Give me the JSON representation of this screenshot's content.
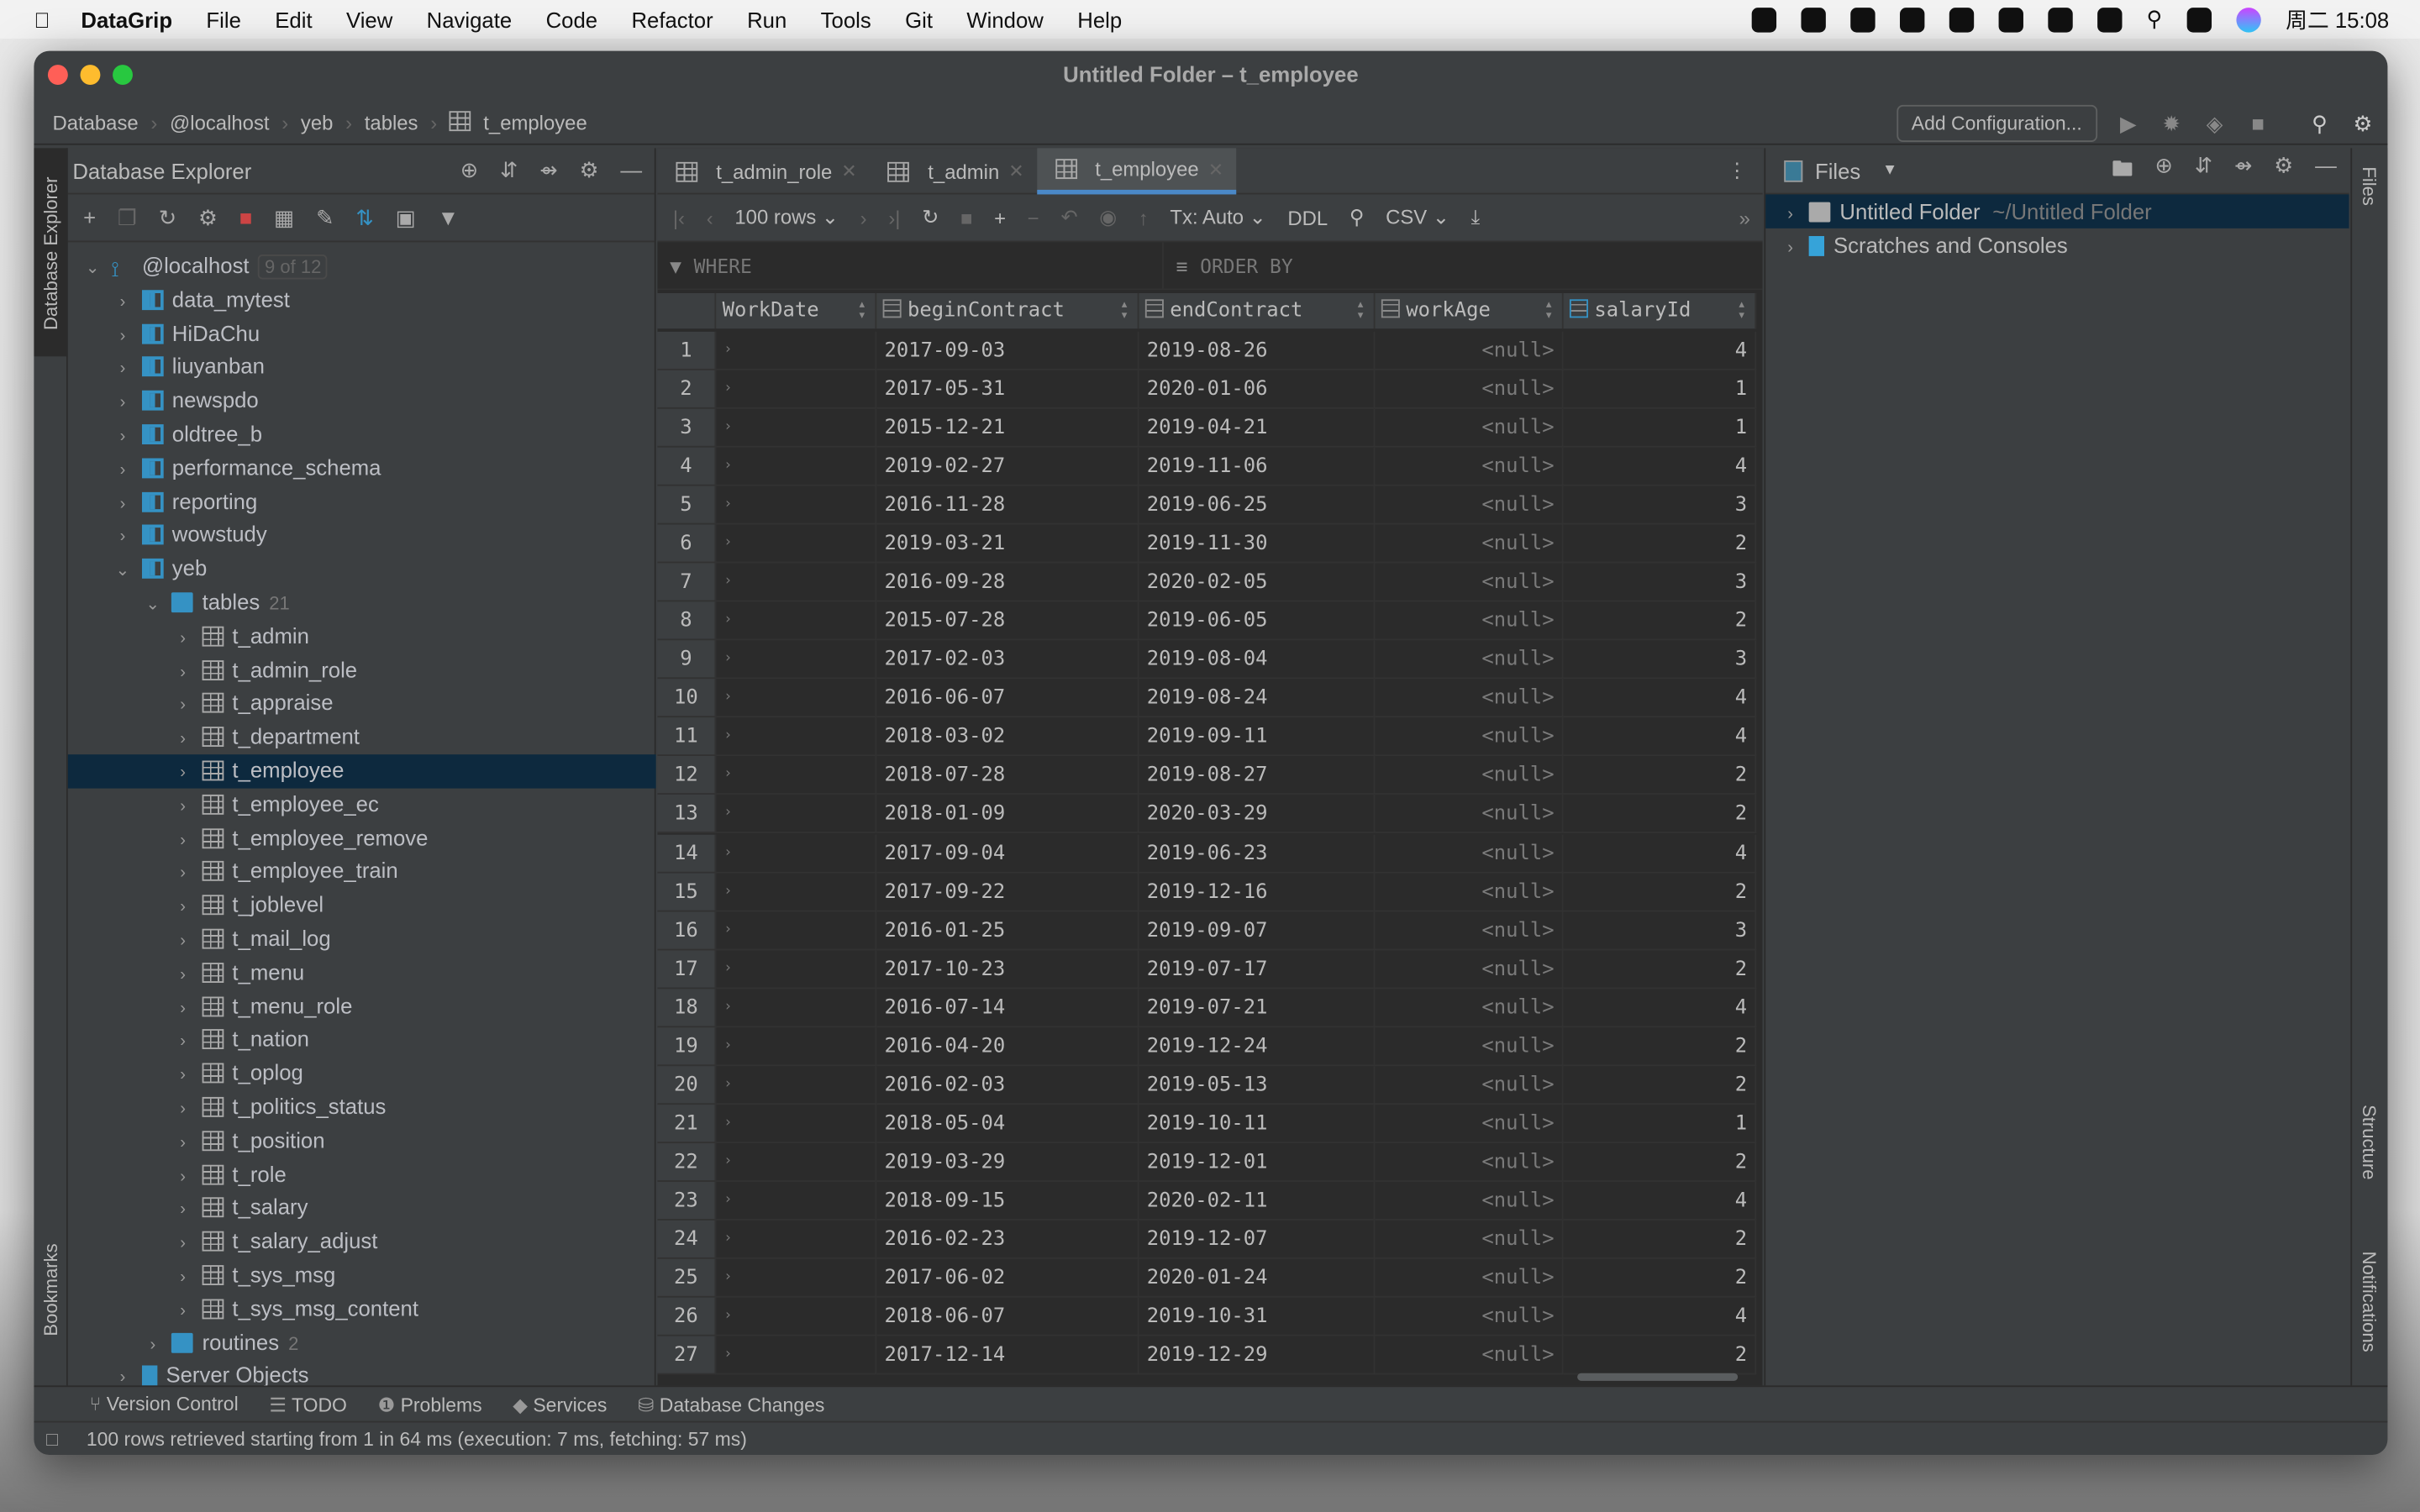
{
  "menubar": {
    "app": "DataGrip",
    "items": [
      "File",
      "Edit",
      "View",
      "Navigate",
      "Code",
      "Refactor",
      "Run",
      "Tools",
      "Git",
      "Window",
      "Help"
    ],
    "clock": "周二 15:08"
  },
  "window": {
    "title": "Untitled Folder – t_employee"
  },
  "breadcrumb": [
    "Database",
    "@localhost",
    "yeb",
    "tables",
    "t_employee"
  ],
  "toolbar": {
    "add_configuration": "Add Configuration..."
  },
  "left_stripe": {
    "database_explorer": "Database Explorer",
    "bookmarks": "Bookmarks"
  },
  "db_explorer": {
    "title": "Database Explorer",
    "tree": [
      {
        "label": "@localhost",
        "level": 0,
        "icon": "mysql-connection-icon",
        "expanded": true,
        "badge": "9 of 12"
      },
      {
        "label": "data_mytest",
        "level": 1,
        "icon": "schema-icon"
      },
      {
        "label": "HiDaChu",
        "level": 1,
        "icon": "schema-icon"
      },
      {
        "label": "liuyanban",
        "level": 1,
        "icon": "schema-icon"
      },
      {
        "label": "newspdo",
        "level": 1,
        "icon": "schema-icon"
      },
      {
        "label": "oldtree_b",
        "level": 1,
        "icon": "schema-icon"
      },
      {
        "label": "performance_schema",
        "level": 1,
        "icon": "schema-icon"
      },
      {
        "label": "reporting",
        "level": 1,
        "icon": "schema-icon"
      },
      {
        "label": "wowstudy",
        "level": 1,
        "icon": "schema-icon"
      },
      {
        "label": "yeb",
        "level": 1,
        "icon": "schema-icon",
        "expanded": true
      },
      {
        "label": "tables",
        "level": 2,
        "icon": "folder-icon",
        "expanded": true,
        "count": "21"
      },
      {
        "label": "t_admin",
        "level": 3,
        "icon": "table-icon"
      },
      {
        "label": "t_admin_role",
        "level": 3,
        "icon": "table-icon"
      },
      {
        "label": "t_appraise",
        "level": 3,
        "icon": "table-icon"
      },
      {
        "label": "t_department",
        "level": 3,
        "icon": "table-icon"
      },
      {
        "label": "t_employee",
        "level": 3,
        "icon": "table-icon",
        "selected": true
      },
      {
        "label": "t_employee_ec",
        "level": 3,
        "icon": "table-icon"
      },
      {
        "label": "t_employee_remove",
        "level": 3,
        "icon": "table-icon"
      },
      {
        "label": "t_employee_train",
        "level": 3,
        "icon": "table-icon"
      },
      {
        "label": "t_joblevel",
        "level": 3,
        "icon": "table-icon"
      },
      {
        "label": "t_mail_log",
        "level": 3,
        "icon": "table-icon"
      },
      {
        "label": "t_menu",
        "level": 3,
        "icon": "table-icon"
      },
      {
        "label": "t_menu_role",
        "level": 3,
        "icon": "table-icon"
      },
      {
        "label": "t_nation",
        "level": 3,
        "icon": "table-icon"
      },
      {
        "label": "t_oplog",
        "level": 3,
        "icon": "table-icon"
      },
      {
        "label": "t_politics_status",
        "level": 3,
        "icon": "table-icon"
      },
      {
        "label": "t_position",
        "level": 3,
        "icon": "table-icon"
      },
      {
        "label": "t_role",
        "level": 3,
        "icon": "table-icon"
      },
      {
        "label": "t_salary",
        "level": 3,
        "icon": "table-icon"
      },
      {
        "label": "t_salary_adjust",
        "level": 3,
        "icon": "table-icon"
      },
      {
        "label": "t_sys_msg",
        "level": 3,
        "icon": "table-icon"
      },
      {
        "label": "t_sys_msg_content",
        "level": 3,
        "icon": "table-icon"
      },
      {
        "label": "routines",
        "level": 2,
        "icon": "folder-icon",
        "count": "2"
      },
      {
        "label": "Server Objects",
        "level": 1,
        "icon": "server-objects-icon"
      }
    ]
  },
  "editor": {
    "tabs": [
      {
        "label": "t_admin_role"
      },
      {
        "label": "t_admin"
      },
      {
        "label": "t_employee",
        "active": true
      }
    ],
    "grid_toolbar": {
      "rows": "100 rows",
      "tx": "Tx: Auto",
      "ddl": "DDL",
      "export": "CSV"
    },
    "filter": {
      "where": "WHERE",
      "order_by": "ORDER BY"
    },
    "columns": [
      "WorkDate",
      "beginContract",
      "endContract",
      "workAge",
      "salaryId"
    ],
    "rows": [
      [
        "2017-09-03",
        "2019-08-26",
        "<null>",
        "4"
      ],
      [
        "2017-05-31",
        "2020-01-06",
        "<null>",
        "1"
      ],
      [
        "2015-12-21",
        "2019-04-21",
        "<null>",
        "1"
      ],
      [
        "2019-02-27",
        "2019-11-06",
        "<null>",
        "4"
      ],
      [
        "2016-11-28",
        "2019-06-25",
        "<null>",
        "3"
      ],
      [
        "2019-03-21",
        "2019-11-30",
        "<null>",
        "2"
      ],
      [
        "2016-09-28",
        "2020-02-05",
        "<null>",
        "3"
      ],
      [
        "2015-07-28",
        "2019-06-05",
        "<null>",
        "2"
      ],
      [
        "2017-02-03",
        "2019-08-04",
        "<null>",
        "3"
      ],
      [
        "2016-06-07",
        "2019-08-24",
        "<null>",
        "4"
      ],
      [
        "2018-03-02",
        "2019-09-11",
        "<null>",
        "4"
      ],
      [
        "2018-07-28",
        "2019-08-27",
        "<null>",
        "2"
      ],
      [
        "2018-01-09",
        "2020-03-29",
        "<null>",
        "2"
      ],
      [
        "2017-09-04",
        "2019-06-23",
        "<null>",
        "4"
      ],
      [
        "2017-09-22",
        "2019-12-16",
        "<null>",
        "2"
      ],
      [
        "2016-01-25",
        "2019-09-07",
        "<null>",
        "3"
      ],
      [
        "2017-10-23",
        "2019-07-17",
        "<null>",
        "2"
      ],
      [
        "2016-07-14",
        "2019-07-21",
        "<null>",
        "4"
      ],
      [
        "2016-04-20",
        "2019-12-24",
        "<null>",
        "2"
      ],
      [
        "2016-02-03",
        "2019-05-13",
        "<null>",
        "2"
      ],
      [
        "2018-05-04",
        "2019-10-11",
        "<null>",
        "1"
      ],
      [
        "2019-03-29",
        "2019-12-01",
        "<null>",
        "2"
      ],
      [
        "2018-09-15",
        "2020-02-11",
        "<null>",
        "4"
      ],
      [
        "2016-02-23",
        "2019-12-07",
        "<null>",
        "2"
      ],
      [
        "2017-06-02",
        "2020-01-24",
        "<null>",
        "2"
      ],
      [
        "2018-06-07",
        "2019-10-31",
        "<null>",
        "4"
      ],
      [
        "2017-12-14",
        "2019-12-29",
        "<null>",
        "2"
      ]
    ]
  },
  "files_panel": {
    "title": "Files",
    "items": [
      {
        "label": "Untitled Folder",
        "path": "~/Untitled Folder",
        "selected": true
      },
      {
        "label": "Scratches and Consoles"
      }
    ]
  },
  "right_stripe": {
    "files": "Files",
    "structure": "Structure",
    "notifications": "Notifications"
  },
  "bottom_tools": [
    "Version Control",
    "TODO",
    "Problems",
    "Services",
    "Database Changes"
  ],
  "status": "100 rows retrieved starting from 1 in 64 ms (execution: 7 ms, fetching: 57 ms)",
  "colors": {
    "selection": "#0d293e",
    "accent": "#4a88c7",
    "schema": "#3592c4"
  }
}
